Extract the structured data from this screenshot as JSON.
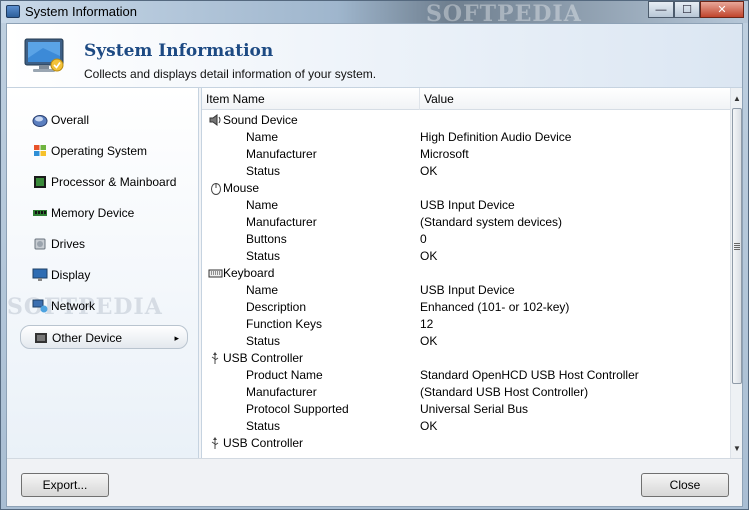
{
  "window": {
    "title": "System Information",
    "watermark_top": "SOFTPEDIA",
    "controls": {
      "minimize": "—",
      "maximize": "☐",
      "close": "✕"
    }
  },
  "header": {
    "title": "System Information",
    "subtitle": "Collects and displays detail information of your system."
  },
  "sidebar": {
    "watermark": "SOFTPEDIA",
    "items": [
      {
        "label": "Overall",
        "icon": "overall-icon"
      },
      {
        "label": "Operating System",
        "icon": "windows-logo-icon"
      },
      {
        "label": "Processor & Mainboard",
        "icon": "processor-chip-icon"
      },
      {
        "label": "Memory Device",
        "icon": "memory-module-icon"
      },
      {
        "label": "Drives",
        "icon": "drive-icon"
      },
      {
        "label": "Display",
        "icon": "display-icon"
      },
      {
        "label": "Network",
        "icon": "network-icon"
      },
      {
        "label": "Other Device",
        "icon": "other-device-icon",
        "selected": true,
        "chevron": "▸"
      }
    ]
  },
  "list": {
    "columns": [
      "Item Name",
      "Value"
    ],
    "rows": [
      {
        "type": "group",
        "label": "Sound Device",
        "icon": "speaker-icon"
      },
      {
        "type": "prop",
        "name": "Name",
        "value": "High Definition Audio Device"
      },
      {
        "type": "prop",
        "name": "Manufacturer",
        "value": "Microsoft"
      },
      {
        "type": "prop",
        "name": "Status",
        "value": "OK"
      },
      {
        "type": "group",
        "label": "Mouse",
        "icon": "mouse-icon"
      },
      {
        "type": "prop",
        "name": "Name",
        "value": "USB Input Device"
      },
      {
        "type": "prop",
        "name": "Manufacturer",
        "value": "(Standard system devices)"
      },
      {
        "type": "prop",
        "name": "Buttons",
        "value": "0"
      },
      {
        "type": "prop",
        "name": "Status",
        "value": "OK"
      },
      {
        "type": "group",
        "label": "Keyboard",
        "icon": "keyboard-icon"
      },
      {
        "type": "prop",
        "name": "Name",
        "value": "USB Input Device"
      },
      {
        "type": "prop",
        "name": "Description",
        "value": "Enhanced (101- or 102-key)"
      },
      {
        "type": "prop",
        "name": "Function Keys",
        "value": "12"
      },
      {
        "type": "prop",
        "name": "Status",
        "value": "OK"
      },
      {
        "type": "group",
        "label": "USB Controller",
        "icon": "usb-icon"
      },
      {
        "type": "prop",
        "name": "Product Name",
        "value": "Standard OpenHCD USB Host Controller"
      },
      {
        "type": "prop",
        "name": "Manufacturer",
        "value": "(Standard USB Host Controller)"
      },
      {
        "type": "prop",
        "name": "Protocol Supported",
        "value": "Universal Serial Bus"
      },
      {
        "type": "prop",
        "name": "Status",
        "value": "OK"
      },
      {
        "type": "group",
        "label": "USB Controller",
        "icon": "usb-icon"
      }
    ]
  },
  "footer": {
    "export_label": "Export...",
    "close_label": "Close"
  }
}
